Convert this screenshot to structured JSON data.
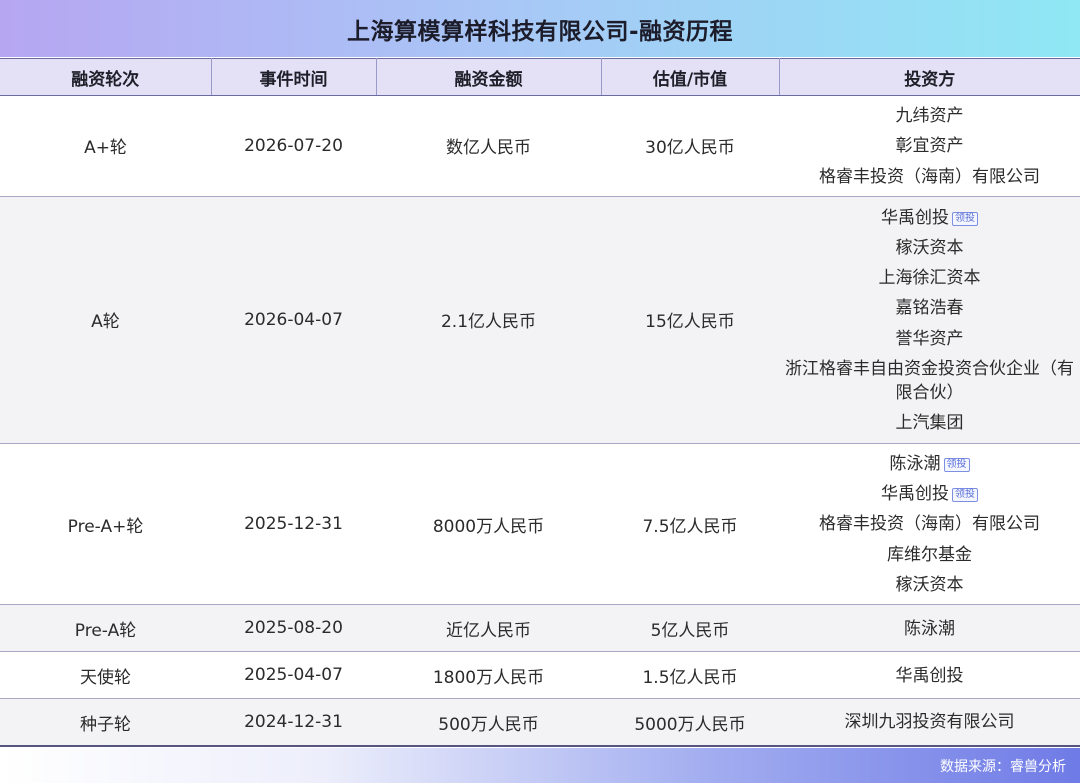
{
  "title": "上海算模算样科技有限公司-融资历程",
  "headers": [
    "融资轮次",
    "事件时间",
    "融资金额",
    "估值/市值",
    "投资方"
  ],
  "lead_badge": "领投",
  "rows": [
    {
      "round": "A+轮",
      "date": "2026-07-20",
      "amount": "数亿人民币",
      "valuation": "30亿人民币",
      "investors": [
        {
          "name": "九纬资产",
          "lead": false
        },
        {
          "name": "彰宜资产",
          "lead": false
        },
        {
          "name": "格睿丰投资（海南）有限公司",
          "lead": false
        }
      ]
    },
    {
      "round": "A轮",
      "date": "2026-04-07",
      "amount": "2.1亿人民币",
      "valuation": "15亿人民币",
      "investors": [
        {
          "name": "华禹创投",
          "lead": true
        },
        {
          "name": "稼沃资本",
          "lead": false
        },
        {
          "name": "上海徐汇资本",
          "lead": false
        },
        {
          "name": "嘉铭浩春",
          "lead": false
        },
        {
          "name": "誉华资产",
          "lead": false
        },
        {
          "name": "浙江格睿丰自由资金投资合伙企业（有限合伙）",
          "lead": false,
          "wrap": true
        },
        {
          "name": "上汽集团",
          "lead": false
        }
      ]
    },
    {
      "round": "Pre-A+轮",
      "date": "2025-12-31",
      "amount": "8000万人民币",
      "valuation": "7.5亿人民币",
      "investors": [
        {
          "name": "陈泳潮",
          "lead": true
        },
        {
          "name": "华禹创投",
          "lead": true
        },
        {
          "name": "格睿丰投资（海南）有限公司",
          "lead": false
        },
        {
          "name": "库维尔基金",
          "lead": false
        },
        {
          "name": "稼沃资本",
          "lead": false
        }
      ]
    },
    {
      "round": "Pre-A轮",
      "date": "2025-08-20",
      "amount": "近亿人民币",
      "valuation": "5亿人民币",
      "investors": [
        {
          "name": "陈泳潮",
          "lead": false
        }
      ]
    },
    {
      "round": "天使轮",
      "date": "2025-04-07",
      "amount": "1800万人民币",
      "valuation": "1.5亿人民币",
      "investors": [
        {
          "name": "华禹创投",
          "lead": false
        }
      ]
    },
    {
      "round": "种子轮",
      "date": "2024-12-31",
      "amount": "500万人民币",
      "valuation": "5000万人民币",
      "investors": [
        {
          "name": "深圳九羽投资有限公司",
          "lead": false
        }
      ]
    }
  ],
  "footer": "数据来源：睿兽分析"
}
